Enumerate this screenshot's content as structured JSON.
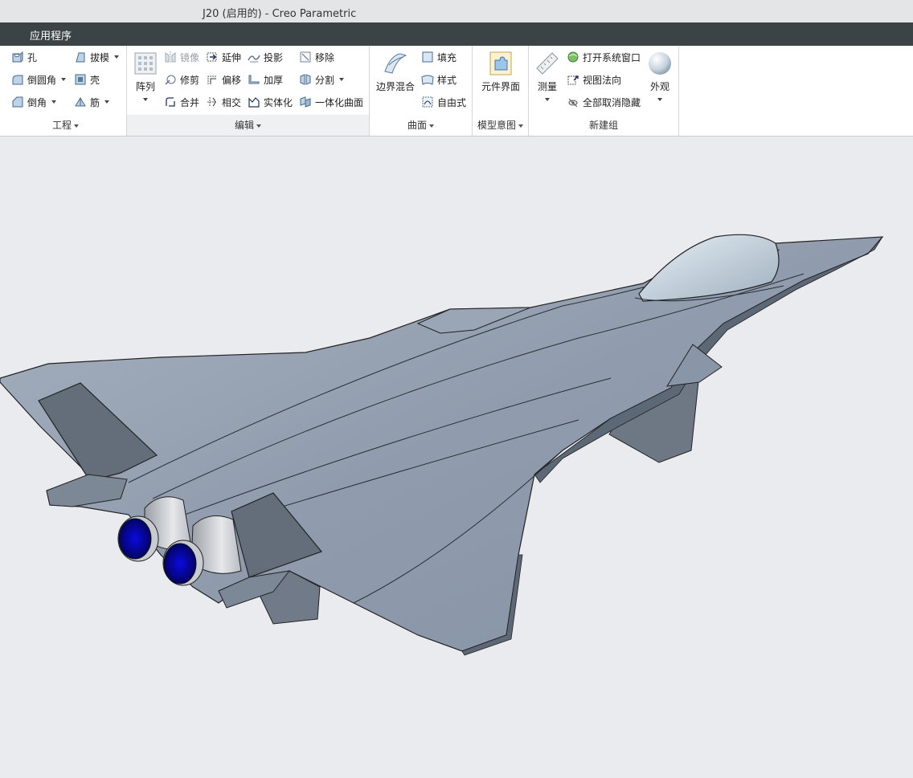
{
  "window": {
    "title": "J20 (启用的) - Creo Parametric"
  },
  "tabs": [
    {
      "label": "应用程序"
    }
  ],
  "ribbon": {
    "engineering": {
      "label": "工程",
      "hole": "孔",
      "draft": "拔模",
      "round": "倒圆角",
      "shell": "壳",
      "chamfer": "倒角",
      "rib": "筋"
    },
    "editing": {
      "label": "编辑",
      "pattern": "阵列",
      "mirror": "镜像",
      "extend": "延伸",
      "project": "投影",
      "remove": "移除",
      "trim": "修剪",
      "offset": "偏移",
      "thicken": "加厚",
      "split": "分割",
      "merge": "合并",
      "intersect": "相交",
      "solidify": "实体化",
      "unify_surfaces": "一体化曲面"
    },
    "surfaces": {
      "label": "曲面",
      "boundary_blend": "边界混合",
      "fill": "填充",
      "style": "样式",
      "freestyle": "自由式"
    },
    "model_intent": {
      "label": "模型意图",
      "component_interface": "元件界面"
    },
    "new_group": {
      "label": "新建组",
      "measure": "测量",
      "open_system_window": "打开系统窗口",
      "view_normal": "视图法向",
      "unhide_all": "全部取消隐藏",
      "appearance": "外观"
    }
  },
  "colors": {
    "tabbar_bg": "#3b4346",
    "model_surface": "#8e9aab",
    "nozzle_blue": "#1010c8"
  }
}
